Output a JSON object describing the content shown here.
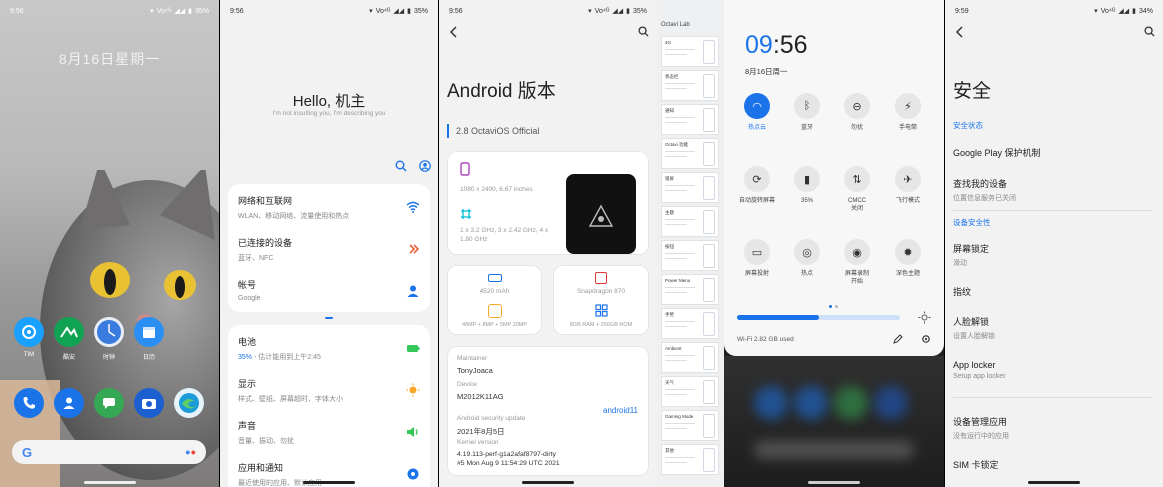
{
  "status_bars": {
    "p1": {
      "time": "9:56",
      "battery": "35%",
      "net": "Vo⁴ᴳ"
    },
    "p2": {
      "time": "9:56",
      "battery": "35%",
      "net": "Vo⁴ᴳ"
    },
    "p3": {
      "time": "9:56",
      "battery": "35%",
      "net": "Vo⁴ᴳ"
    },
    "p6": {
      "time": "9:59",
      "battery": "34%",
      "net": "Vo⁴ᴳ"
    }
  },
  "home": {
    "date": "8月16日星期一",
    "apps_row1": [
      {
        "label": "TIM",
        "icon": "tim-icon",
        "color": "#1aa1ff"
      },
      {
        "label": "酷安",
        "icon": "coolapk-icon",
        "color": "#11a354"
      },
      {
        "label": "时钟",
        "icon": "clock-icon",
        "color": "#3a7be0"
      },
      {
        "label": "日历",
        "icon": "calendar-icon",
        "color": "#2b8ef3"
      }
    ],
    "dock": [
      {
        "icon": "phone-icon",
        "color": "#1a73e8"
      },
      {
        "icon": "contacts-icon",
        "color": "#1a73e8"
      },
      {
        "icon": "messages-icon",
        "color": "#34a853"
      },
      {
        "icon": "camera-icon",
        "color": "#1c5fd0"
      },
      {
        "icon": "edge-icon",
        "color": "#1d9bd8"
      }
    ]
  },
  "settings": {
    "hello": "Hello, 机主",
    "subtitle": "I'm not insulting you, I'm describing you",
    "group1": [
      {
        "title": "网络和互联网",
        "sub": "WLAN、移动网络、流量使用和热点",
        "icon": "wifi-icon",
        "color": "#1a73e8"
      },
      {
        "title": "已连接的设备",
        "sub": "蓝牙、NFC",
        "icon": "devices-icon",
        "color": "#e8603c"
      },
      {
        "title": "帐号",
        "sub": "Google",
        "icon": "account-icon",
        "color": "#1a73e8"
      }
    ],
    "group2": [
      {
        "title": "电池",
        "sub_highlight": "35%",
        "sub": " - 估计能用到上午2:45",
        "icon": "battery-icon",
        "color": "#34c759"
      },
      {
        "title": "显示",
        "sub": "样式、壁纸、屏幕超时、字体大小",
        "icon": "brightness-icon",
        "color": "#f9a825"
      },
      {
        "title": "声音",
        "sub": "音量、振动、勿扰",
        "icon": "sound-icon",
        "color": "#34c759"
      },
      {
        "title": "应用和通知",
        "sub": "最近使用的应用、默认应用",
        "icon": "apps-icon",
        "color": "#1a73e8"
      }
    ]
  },
  "android": {
    "title": "Android 版本",
    "version": "2.8 OctaviOS Official",
    "display_res": "1080 x 2400, 6.67 inches",
    "cpu": "1 x 3.2 GHz, 3 x 2.42 GHz, 4 x 1.80 GHz",
    "battery": "4520 mAh",
    "soc": "Snapdragon 870",
    "camera": "48MP + 8MP + 5MP 20MP",
    "memory": "8GB RAM + 256GB ROM",
    "maintainer_label": "Maintainer",
    "maintainer": "TonyJoaca",
    "device_label": "Device",
    "device": "M2012K11AG",
    "patch_label": "Android security update",
    "patch": "2021年8月5日",
    "kernel_label": "Kernel version",
    "kernel": "4.19.113-perf-g1a2afaf8797-dirty",
    "kernel_date": "#5 Mon Aug 9 11:54:29 UTC 2021",
    "android_logo": "android11"
  },
  "octavi_list": {
    "title": "Octavi Lab",
    "items": [
      "4G",
      "状态栏",
      "通知",
      "Octavi 功能",
      "锁屏",
      "主题",
      "按钮",
      "Power Menu",
      "手势",
      "Ambient",
      "天气",
      "Gaming Mode",
      "其他"
    ]
  },
  "quick_settings": {
    "hour": "09",
    "minute": ":56",
    "date": "8月16日周一",
    "tiles": [
      {
        "label": "热点云",
        "icon": "wifi-icon",
        "on": true
      },
      {
        "label": "蓝牙",
        "icon": "bluetooth-icon",
        "on": false
      },
      {
        "label": "勿扰",
        "icon": "dnd-icon",
        "on": false
      },
      {
        "label": "手电筒",
        "icon": "flashlight-icon",
        "on": false
      },
      {
        "label": "自动旋转屏幕",
        "icon": "rotate-icon",
        "on": false
      },
      {
        "label": "35%",
        "icon": "battery-saver-icon",
        "on": false
      },
      {
        "label": "CMCC\n关闭",
        "icon": "data-icon",
        "on": false
      },
      {
        "label": "飞行模式",
        "icon": "airplane-icon",
        "on": false
      },
      {
        "label": "屏幕投射",
        "icon": "cast-icon",
        "on": false
      },
      {
        "label": "热点",
        "icon": "hotspot-icon",
        "on": false
      },
      {
        "label": "屏幕录制\n开始",
        "icon": "record-icon",
        "on": false
      },
      {
        "label": "深色主题",
        "icon": "dark-theme-icon",
        "on": false
      }
    ],
    "brightness": 0.5,
    "data_usage": "Wi-Fi 2.82 GB used"
  },
  "security": {
    "title": "安全",
    "section1": "安全状态",
    "section2": "设备安全性",
    "rows": [
      {
        "title": "Google Play 保护机制",
        "sub": ""
      },
      {
        "title": "查找我的设备",
        "sub": "位置信息服务已关闭"
      },
      {
        "title": "屏幕锁定",
        "sub": "滑动"
      },
      {
        "title": "指纹",
        "sub": ""
      },
      {
        "title": "人脸解锁",
        "sub": "设置人脸解锁"
      },
      {
        "title": "App locker",
        "sub": "Setup app locker"
      },
      {
        "title": "设备管理应用",
        "sub": "没有运行中的应用"
      },
      {
        "title": "SIM 卡锁定",
        "sub": ""
      }
    ]
  }
}
